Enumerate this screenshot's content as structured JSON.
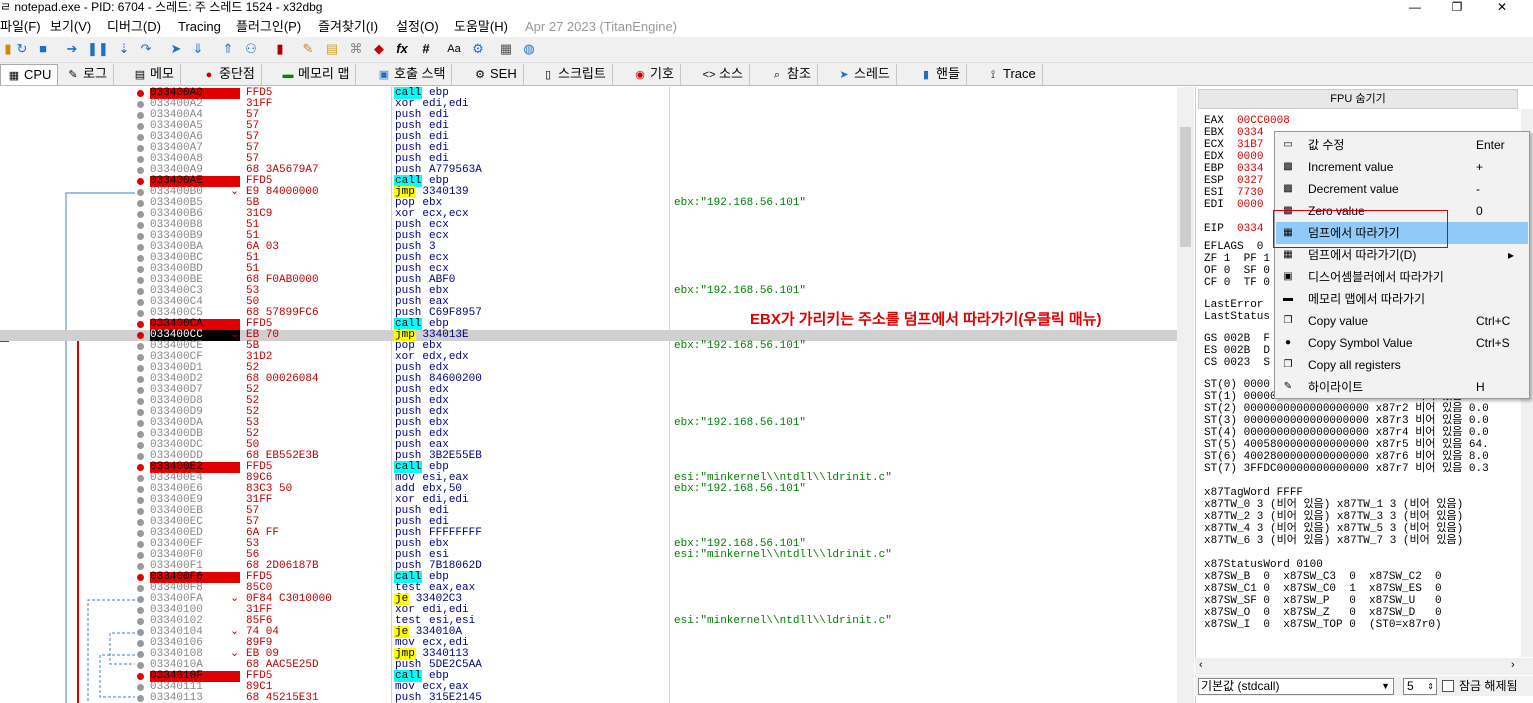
{
  "window": {
    "title": "ㄹ notepad.exe - PID: 6704 - 스레드: 주 스레드 1524 - x32dbg",
    "min": "—",
    "max": "❐",
    "close": "✕"
  },
  "menu": [
    "파일(F)",
    "보기(V)",
    "디버그(D)",
    "Tracing",
    "플러그인(P)",
    "즐겨찾기(I)",
    "설정(O)",
    "도움말(H)",
    "Apr 27 2023 (TitanEngine)"
  ],
  "tabs": [
    {
      "label": "CPU",
      "icon": "cpu-icon",
      "glyph": "▦"
    },
    {
      "label": "로그",
      "icon": "log-icon",
      "glyph": "✎"
    },
    {
      "label": "메모",
      "icon": "notes-icon",
      "glyph": "▤"
    },
    {
      "label": "중단점",
      "icon": "breakpoint-icon",
      "glyph": "●"
    },
    {
      "label": "메모리 맵",
      "icon": "memory-map-icon",
      "glyph": "▬"
    },
    {
      "label": "호출 스택",
      "icon": "call-stack-icon",
      "glyph": "▣"
    },
    {
      "label": "SEH",
      "icon": "seh-icon",
      "glyph": "⚙"
    },
    {
      "label": "스크립트",
      "icon": "script-icon",
      "glyph": "▯"
    },
    {
      "label": "기호",
      "icon": "symbols-icon",
      "glyph": "◉"
    },
    {
      "label": "소스",
      "icon": "source-icon",
      "glyph": "<>"
    },
    {
      "label": "참조",
      "icon": "references-icon",
      "glyph": "⌕"
    },
    {
      "label": "스레드",
      "icon": "threads-icon",
      "glyph": "➤"
    },
    {
      "label": "핸들",
      "icon": "handles-icon",
      "glyph": "▮"
    },
    {
      "label": "Trace",
      "icon": "trace-icon",
      "glyph": "⟟"
    }
  ],
  "toolbar_icons": [
    "open-icon",
    "restart-icon",
    "stop-icon",
    "run-icon",
    "pause-icon",
    "step-into-icon",
    "step-over-icon",
    "trace-into-icon",
    "trace-over-icon",
    "execute-till-return-icon",
    "run-to-user-code-icon",
    "bookmark-icon",
    "patch-icon",
    "comment-icon",
    "label-icon",
    "function-icon",
    "fx-icon",
    "hash-icon",
    "font-icon",
    "settings-icon",
    "calculator-icon",
    "globe-icon"
  ],
  "disasm": [
    {
      "addr": "033400A0",
      "bytes": "FFD5",
      "mn": "call",
      "op": " ebp",
      "cls": "call",
      "flag": "ret",
      "cmt": ""
    },
    {
      "addr": "033400A2",
      "bytes": "31FF",
      "mn": "xor",
      "op": " edi,edi",
      "cls": "",
      "flag": "",
      "cmt": ""
    },
    {
      "addr": "033400A4",
      "bytes": "57",
      "mn": "push",
      "op": " edi",
      "cls": "",
      "flag": "",
      "cmt": ""
    },
    {
      "addr": "033400A5",
      "bytes": "57",
      "mn": "push",
      "op": " edi",
      "cls": "",
      "flag": "",
      "cmt": ""
    },
    {
      "addr": "033400A6",
      "bytes": "57",
      "mn": "push",
      "op": " edi",
      "cls": "",
      "flag": "",
      "cmt": ""
    },
    {
      "addr": "033400A7",
      "bytes": "57",
      "mn": "push",
      "op": " edi",
      "cls": "",
      "flag": "",
      "cmt": ""
    },
    {
      "addr": "033400A8",
      "bytes": "57",
      "mn": "push",
      "op": " edi",
      "cls": "",
      "flag": "",
      "cmt": ""
    },
    {
      "addr": "033400A9",
      "bytes": "68 3A5679A7",
      "mn": "push",
      "op": " A779563A",
      "cls": "",
      "flag": "",
      "cmt": ""
    },
    {
      "addr": "033400AE",
      "bytes": "FFD5",
      "mn": "call",
      "op": " ebp",
      "cls": "call",
      "flag": "ret",
      "cmt": ""
    },
    {
      "addr": "033400B0",
      "bytes": "E9 84000000",
      "mn": "jmp",
      "op": " 3340139",
      "cls": "jmp",
      "flag": "",
      "cmt": ""
    },
    {
      "addr": "033400B5",
      "bytes": "5B",
      "mn": "pop",
      "op": " ebx",
      "cls": "",
      "flag": "",
      "cmt": "ebx:\"192.168.56.101\""
    },
    {
      "addr": "033400B6",
      "bytes": "31C9",
      "mn": "xor",
      "op": " ecx,ecx",
      "cls": "",
      "flag": "",
      "cmt": ""
    },
    {
      "addr": "033400B8",
      "bytes": "51",
      "mn": "push",
      "op": " ecx",
      "cls": "",
      "flag": "",
      "cmt": ""
    },
    {
      "addr": "033400B9",
      "bytes": "51",
      "mn": "push",
      "op": " ecx",
      "cls": "",
      "flag": "",
      "cmt": ""
    },
    {
      "addr": "033400BA",
      "bytes": "6A 03",
      "mn": "push",
      "op": " 3",
      "cls": "",
      "flag": "",
      "cmt": ""
    },
    {
      "addr": "033400BC",
      "bytes": "51",
      "mn": "push",
      "op": " ecx",
      "cls": "",
      "flag": "",
      "cmt": ""
    },
    {
      "addr": "033400BD",
      "bytes": "51",
      "mn": "push",
      "op": " ecx",
      "cls": "",
      "flag": "",
      "cmt": ""
    },
    {
      "addr": "033400BE",
      "bytes": "68 F0AB0000",
      "mn": "push",
      "op": " ABF0",
      "cls": "",
      "flag": "",
      "cmt": ""
    },
    {
      "addr": "033400C3",
      "bytes": "53",
      "mn": "push",
      "op": " ebx",
      "cls": "",
      "flag": "",
      "cmt": "ebx:\"192.168.56.101\""
    },
    {
      "addr": "033400C4",
      "bytes": "50",
      "mn": "push",
      "op": " eax",
      "cls": "",
      "flag": "",
      "cmt": ""
    },
    {
      "addr": "033400C5",
      "bytes": "68 57899FC6",
      "mn": "push",
      "op": " C69F8957",
      "cls": "",
      "flag": "",
      "cmt": ""
    },
    {
      "addr": "033400CA",
      "bytes": "FFD5",
      "mn": "call",
      "op": " ebp",
      "cls": "call",
      "flag": "ret",
      "cmt": ""
    },
    {
      "addr": "033400CC",
      "bytes": "EB 70",
      "mn": "jmp",
      "op": " 334013E",
      "cls": "jmp",
      "flag": "cur",
      "cmt": ""
    },
    {
      "addr": "033400CE",
      "bytes": "5B",
      "mn": "pop",
      "op": " ebx",
      "cls": "",
      "flag": "",
      "cmt": "ebx:\"192.168.56.101\""
    },
    {
      "addr": "033400CF",
      "bytes": "31D2",
      "mn": "xor",
      "op": " edx,edx",
      "cls": "",
      "flag": "",
      "cmt": ""
    },
    {
      "addr": "033400D1",
      "bytes": "52",
      "mn": "push",
      "op": " edx",
      "cls": "",
      "flag": "",
      "cmt": ""
    },
    {
      "addr": "033400D2",
      "bytes": "68 00026084",
      "mn": "push",
      "op": " 84600200",
      "cls": "",
      "flag": "",
      "cmt": ""
    },
    {
      "addr": "033400D7",
      "bytes": "52",
      "mn": "push",
      "op": " edx",
      "cls": "",
      "flag": "",
      "cmt": ""
    },
    {
      "addr": "033400D8",
      "bytes": "52",
      "mn": "push",
      "op": " edx",
      "cls": "",
      "flag": "",
      "cmt": ""
    },
    {
      "addr": "033400D9",
      "bytes": "52",
      "mn": "push",
      "op": " edx",
      "cls": "",
      "flag": "",
      "cmt": ""
    },
    {
      "addr": "033400DA",
      "bytes": "53",
      "mn": "push",
      "op": " ebx",
      "cls": "",
      "flag": "",
      "cmt": "ebx:\"192.168.56.101\""
    },
    {
      "addr": "033400DB",
      "bytes": "52",
      "mn": "push",
      "op": " edx",
      "cls": "",
      "flag": "",
      "cmt": ""
    },
    {
      "addr": "033400DC",
      "bytes": "50",
      "mn": "push",
      "op": " eax",
      "cls": "",
      "flag": "",
      "cmt": ""
    },
    {
      "addr": "033400DD",
      "bytes": "68 EB552E3B",
      "mn": "push",
      "op": " 3B2E55EB",
      "cls": "",
      "flag": "",
      "cmt": ""
    },
    {
      "addr": "033400E2",
      "bytes": "FFD5",
      "mn": "call",
      "op": " ebp",
      "cls": "call",
      "flag": "ret",
      "cmt": ""
    },
    {
      "addr": "033400E4",
      "bytes": "89C6",
      "mn": "mov",
      "op": " esi,eax",
      "cls": "",
      "flag": "",
      "cmt": "esi:\"minkernel\\\\ntdll\\\\ldrinit.c\""
    },
    {
      "addr": "033400E6",
      "bytes": "83C3 50",
      "mn": "add",
      "op": " ebx,50",
      "cls": "",
      "flag": "",
      "cmt": "ebx:\"192.168.56.101\""
    },
    {
      "addr": "033400E9",
      "bytes": "31FF",
      "mn": "xor",
      "op": " edi,edi",
      "cls": "",
      "flag": "",
      "cmt": ""
    },
    {
      "addr": "033400EB",
      "bytes": "57",
      "mn": "push",
      "op": " edi",
      "cls": "",
      "flag": "",
      "cmt": ""
    },
    {
      "addr": "033400EC",
      "bytes": "57",
      "mn": "push",
      "op": " edi",
      "cls": "",
      "flag": "",
      "cmt": ""
    },
    {
      "addr": "033400ED",
      "bytes": "6A FF",
      "mn": "push",
      "op": " FFFFFFFF",
      "cls": "",
      "flag": "",
      "cmt": ""
    },
    {
      "addr": "033400EF",
      "bytes": "53",
      "mn": "push",
      "op": " ebx",
      "cls": "",
      "flag": "",
      "cmt": "ebx:\"192.168.56.101\""
    },
    {
      "addr": "033400F0",
      "bytes": "56",
      "mn": "push",
      "op": " esi",
      "cls": "",
      "flag": "",
      "cmt": "esi:\"minkernel\\\\ntdll\\\\ldrinit.c\""
    },
    {
      "addr": "033400F1",
      "bytes": "68 2D06187B",
      "mn": "push",
      "op": " 7B18062D",
      "cls": "",
      "flag": "",
      "cmt": ""
    },
    {
      "addr": "033400F6",
      "bytes": "FFD5",
      "mn": "call",
      "op": " ebp",
      "cls": "call",
      "flag": "ret",
      "cmt": ""
    },
    {
      "addr": "033400F8",
      "bytes": "85C0",
      "mn": "test",
      "op": " eax,eax",
      "cls": "",
      "flag": "",
      "cmt": ""
    },
    {
      "addr": "033400FA",
      "bytes": "0F84 C3010000",
      "mn": "je",
      "op": " 33402C3",
      "cls": "jmp",
      "flag": "",
      "cmt": ""
    },
    {
      "addr": "03340100",
      "bytes": "31FF",
      "mn": "xor",
      "op": " edi,edi",
      "cls": "",
      "flag": "",
      "cmt": ""
    },
    {
      "addr": "03340102",
      "bytes": "85F6",
      "mn": "test",
      "op": " esi,esi",
      "cls": "",
      "flag": "",
      "cmt": "esi:\"minkernel\\\\ntdll\\\\ldrinit.c\""
    },
    {
      "addr": "03340104",
      "bytes": "74 04",
      "mn": "je",
      "op": " 334010A",
      "cls": "jmp",
      "flag": "",
      "cmt": ""
    },
    {
      "addr": "03340106",
      "bytes": "89F9",
      "mn": "mov",
      "op": " ecx,edi",
      "cls": "",
      "flag": "",
      "cmt": ""
    },
    {
      "addr": "03340108",
      "bytes": "EB 09",
      "mn": "jmp",
      "op": " 3340113",
      "cls": "jmp",
      "flag": "",
      "cmt": ""
    },
    {
      "addr": "0334010A",
      "bytes": "68 AAC5E25D",
      "mn": "push",
      "op": " 5DE2C5AA",
      "cls": "",
      "flag": "",
      "cmt": ""
    },
    {
      "addr": "0334010F",
      "bytes": "FFD5",
      "mn": "call",
      "op": " ebp",
      "cls": "call",
      "flag": "ret",
      "cmt": ""
    },
    {
      "addr": "03340111",
      "bytes": "89C1",
      "mn": "mov",
      "op": " ecx,eax",
      "cls": "",
      "flag": "",
      "cmt": ""
    },
    {
      "addr": "03340113",
      "bytes": "68 45215E31",
      "mn": "push",
      "op": " 315E2145",
      "cls": "",
      "flag": "",
      "cmt": ""
    }
  ],
  "annotation": "EBX가 가리키는 주소를 덤프에서 따라가기(우클릭 매뉴)",
  "eip_marker": "P",
  "fpu": {
    "header": "FPU 숨기기",
    "regs": [
      {
        "n": "EAX",
        "v": "00CC0008",
        "rest": ""
      },
      {
        "n": "EBX",
        "v": "0334",
        "rest": ""
      },
      {
        "n": "ECX",
        "v": "31B7",
        "rest": ""
      },
      {
        "n": "EDX",
        "v": "0000",
        "rest": ""
      },
      {
        "n": "EBP",
        "v": "0334",
        "rest": ""
      },
      {
        "n": "ESP",
        "v": "0327",
        "rest": ""
      },
      {
        "n": "ESI",
        "v": "7730",
        "rest": ""
      },
      {
        "n": "EDI",
        "v": "0000",
        "rest": ""
      },
      {
        "n": "EIP",
        "v": "0334",
        "rest": ""
      }
    ],
    "eflags": "EFLAGS  0",
    "flags": [
      "ZF 1  PF 1",
      "OF 0  SF 0",
      "CF 0  TF 0"
    ],
    "last": [
      "LastError",
      "LastStatus"
    ],
    "segs": [
      "GS 002B  F",
      "ES 002B  D",
      "CS 0023  S"
    ],
    "st": [
      "ST(0) 0000",
      "ST(1) 0000000000000000000 x87r1 비어 있음 0.0",
      "ST(2) 0000000000000000000 x87r2 비어 있음 0.0",
      "ST(3) 0000000000000000000 x87r3 비어 있음 0.0",
      "ST(4) 0000000000000000000 x87r4 비어 있음 0.0",
      "ST(5) 4005800000000000000 x87r5 비어 있음 64.",
      "ST(6) 4002800000000000000 x87r6 비어 있음 8.0",
      "ST(7) 3FFDC00000000000000 x87r7 비어 있음 0.3"
    ],
    "tag": [
      "x87TagWord FFFF",
      "x87TW_0 3 (비어 있음) x87TW_1 3 (비어 있음)",
      "x87TW_2 3 (비어 있음) x87TW_3 3 (비어 있음)",
      "x87TW_4 3 (비어 있음) x87TW_5 3 (비어 있음)",
      "x87TW_6 3 (비어 있음) x87TW_7 3 (비어 있음)"
    ],
    "status": [
      "x87StatusWord 0100",
      "x87SW_B  0  x87SW_C3  0  x87SW_C2  0",
      "x87SW_C1 0  x87SW_C0  1  x87SW_ES  0",
      "x87SW_SF 0  x87SW_P   0  x87SW_U   0",
      "x87SW_O  0  x87SW_Z   0  x87SW_D   0",
      "x87SW_I  0  x87SW_TOP 0  (ST0=x87r0)"
    ]
  },
  "context_menu": [
    {
      "label": "값 수정",
      "shortcut": "Enter",
      "icon": "edit-value-icon",
      "glyph": "▭",
      "sub": false,
      "hl": false
    },
    {
      "label": "Increment value",
      "shortcut": "+",
      "icon": "increment-icon",
      "glyph": "▩",
      "sub": false,
      "hl": false
    },
    {
      "label": "Decrement value",
      "shortcut": "-",
      "icon": "decrement-icon",
      "glyph": "▩",
      "sub": false,
      "hl": false
    },
    {
      "label": "Zero value",
      "shortcut": "0",
      "icon": "zero-value-icon",
      "glyph": "▩",
      "sub": false,
      "hl": false
    },
    {
      "label": "덤프에서 따라가기",
      "shortcut": "",
      "icon": "follow-dump-icon",
      "glyph": "▦",
      "sub": false,
      "hl": true
    },
    {
      "label": "덤프에서 따라가기(D)",
      "shortcut": "",
      "icon": "follow-dump-submenu-icon",
      "glyph": "▦",
      "sub": true,
      "hl": false
    },
    {
      "label": "디스어셈블러에서 따라가기",
      "shortcut": "",
      "icon": "follow-disassembler-icon",
      "glyph": "▣",
      "sub": false,
      "hl": false
    },
    {
      "label": "메모리 맵에서 따라가기",
      "shortcut": "",
      "icon": "follow-memory-map-icon",
      "glyph": "▬",
      "sub": false,
      "hl": false
    },
    {
      "label": "Copy value",
      "shortcut": "Ctrl+C",
      "icon": "copy-icon",
      "glyph": "❐",
      "sub": false,
      "hl": false
    },
    {
      "label": "Copy Symbol Value",
      "shortcut": "Ctrl+S",
      "icon": "copy-symbol-icon",
      "glyph": "●",
      "sub": false,
      "hl": false
    },
    {
      "label": "Copy all registers",
      "shortcut": "",
      "icon": "copy-all-icon",
      "glyph": "❐",
      "sub": false,
      "hl": false
    },
    {
      "label": "하이라이트",
      "shortcut": "H",
      "icon": "highlight-icon",
      "glyph": "✎",
      "sub": false,
      "hl": false
    }
  ],
  "bottom": {
    "convention": "기본값 (stdcall)",
    "count": "5",
    "lock": "잠금 해제됨"
  },
  "colors": {
    "accent_red": "#e00000",
    "call_bg": "#00ffff",
    "jmp_bg": "#ffff00",
    "menu_highlight": "#91c9f7"
  }
}
